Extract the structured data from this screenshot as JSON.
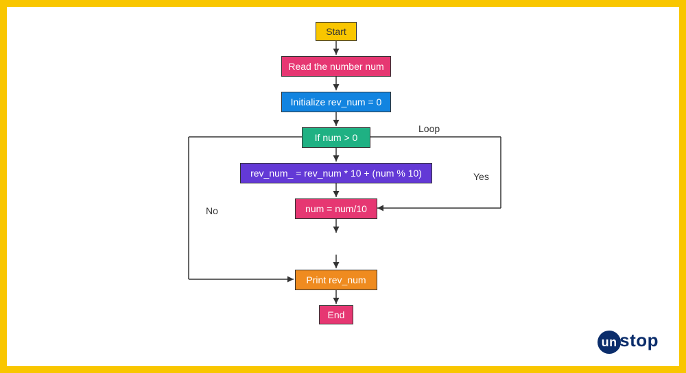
{
  "nodes": {
    "start": {
      "label": "Start",
      "color": "#f9c600"
    },
    "read": {
      "label": "Read the number num",
      "color": "#e63772"
    },
    "init": {
      "label": "Initialize rev_num = 0",
      "color": "#1284e0"
    },
    "cond": {
      "label": "If num > 0",
      "color": "#1fb183"
    },
    "compute": {
      "label": "rev_num_ = rev_num * 10 + (num % 10)",
      "color": "#6339d6"
    },
    "divide": {
      "label": "num = num/10",
      "color": "#e63772"
    },
    "print": {
      "label": "Print rev_num",
      "color": "#ef8b1f"
    },
    "end": {
      "label": "End",
      "color": "#e63772"
    }
  },
  "labels": {
    "loop": "Loop",
    "yes": "Yes",
    "no": "No"
  },
  "brand": {
    "prefix": "un",
    "suffix": "stop"
  }
}
